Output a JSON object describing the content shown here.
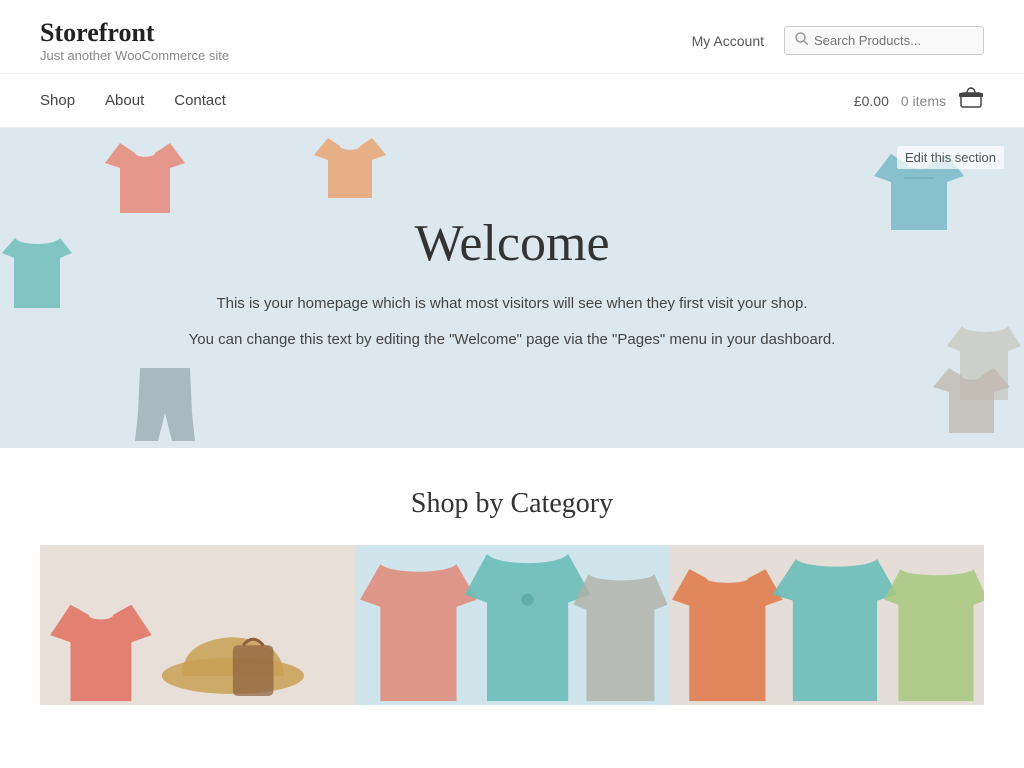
{
  "site": {
    "title": "Storefront",
    "tagline": "Just another WooCommerce site"
  },
  "header": {
    "my_account_label": "My Account",
    "search_placeholder": "Search Products..."
  },
  "nav": {
    "links": [
      {
        "label": "Shop",
        "id": "shop"
      },
      {
        "label": "About",
        "id": "about"
      },
      {
        "label": "Contact",
        "id": "contact"
      }
    ],
    "cart_total": "£0.00",
    "cart_items": "0 items"
  },
  "hero": {
    "title": "Welcome",
    "text1": "This is your homepage which is what most visitors will see when they first visit your shop.",
    "text2": "You can change this text by editing the \"Welcome\" page via the \"Pages\" menu in your dashboard.",
    "edit_label": "Edit this section"
  },
  "shop_section": {
    "title": "Shop by Category"
  },
  "colors": {
    "hero_bg": "#dce8ee",
    "accent": "#2c7be5"
  }
}
